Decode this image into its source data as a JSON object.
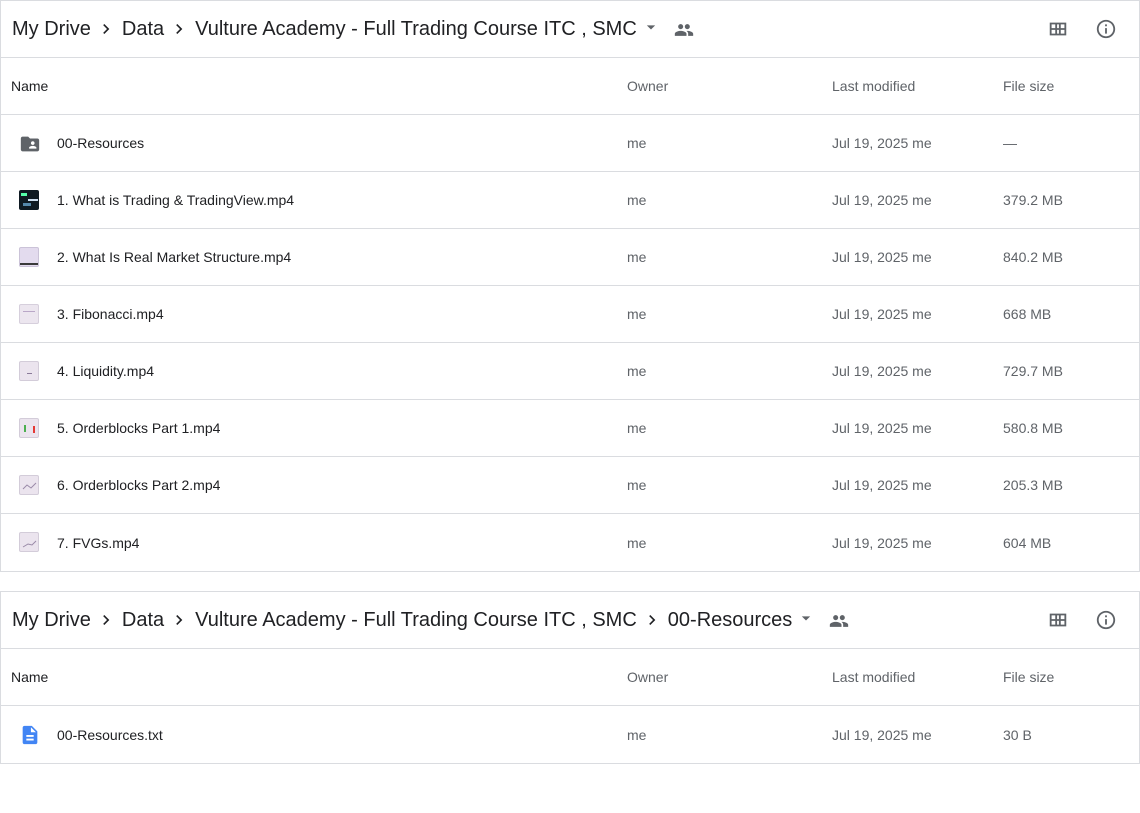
{
  "panel1": {
    "breadcrumb": [
      "My Drive",
      "Data",
      "Vulture Academy - Full Trading Course ITC , SMC"
    ],
    "columns": {
      "name": "Name",
      "owner": "Owner",
      "modified": "Last modified",
      "size": "File size"
    },
    "rows": [
      {
        "name": "00-Resources",
        "owner": "me",
        "modified": "Jul 19, 2025 me",
        "size": "—",
        "icon": "shared-folder-icon"
      },
      {
        "name": "1. What is Trading & TradingView.mp4",
        "owner": "me",
        "modified": "Jul 19, 2025 me",
        "size": "379.2 MB",
        "icon": "video-thumbnail"
      },
      {
        "name": "2. What Is Real Market Structure.mp4",
        "owner": "me",
        "modified": "Jul 19, 2025 me",
        "size": "840.2 MB",
        "icon": "video-thumbnail"
      },
      {
        "name": "3. Fibonacci.mp4",
        "owner": "me",
        "modified": "Jul 19, 2025 me",
        "size": "668 MB",
        "icon": "video-thumbnail"
      },
      {
        "name": "4. Liquidity.mp4",
        "owner": "me",
        "modified": "Jul 19, 2025 me",
        "size": "729.7 MB",
        "icon": "video-thumbnail"
      },
      {
        "name": "5. Orderblocks Part 1.mp4",
        "owner": "me",
        "modified": "Jul 19, 2025 me",
        "size": "580.8 MB",
        "icon": "video-thumbnail"
      },
      {
        "name": "6. Orderblocks Part 2.mp4",
        "owner": "me",
        "modified": "Jul 19, 2025 me",
        "size": "205.3 MB",
        "icon": "video-thumbnail"
      },
      {
        "name": "7. FVGs.mp4",
        "owner": "me",
        "modified": "Jul 19, 2025 me",
        "size": "604 MB",
        "icon": "video-thumbnail"
      }
    ]
  },
  "panel2": {
    "breadcrumb": [
      "My Drive",
      "Data",
      "Vulture Academy - Full Trading Course ITC , SMC",
      "00-Resources"
    ],
    "columns": {
      "name": "Name",
      "owner": "Owner",
      "modified": "Last modified",
      "size": "File size"
    },
    "rows": [
      {
        "name": "00-Resources.txt",
        "owner": "me",
        "modified": "Jul 19, 2025 me",
        "size": "30 B",
        "icon": "text-document-icon"
      }
    ]
  },
  "colors": {
    "doc_blue": "#4285f4",
    "icon_grey": "#5f6368",
    "border": "#dadce0"
  }
}
